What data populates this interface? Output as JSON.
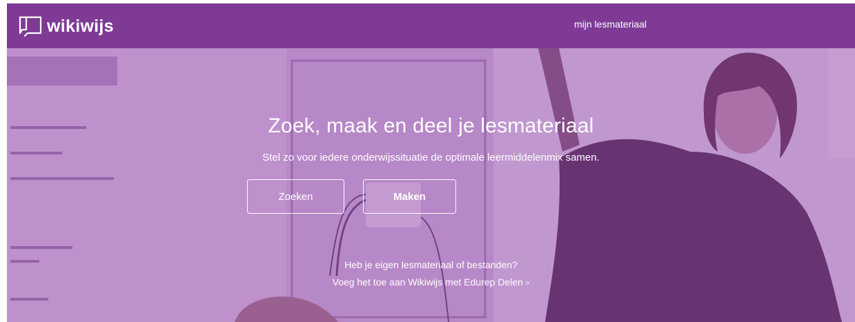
{
  "header": {
    "logo_text": "wikiwijs",
    "logo_icon": "speech-book-icon",
    "nav_link": "mijn lesmateriaal",
    "background_color": "#7f3a96"
  },
  "hero": {
    "title": "Zoek, maak en deel je lesmateriaal",
    "subtitle": "Stel zo voor iedere onderwijssituatie de optimale leermiddelenmix samen.",
    "buttons": {
      "search_label": "Zoeken",
      "make_label": "Maken"
    },
    "note": "Heb je eigen lesmateriaal of bestanden?",
    "link_text": "Voeg het toe aan Wikiwijs met Edurep Delen",
    "link_icon": "chevron-right-icon",
    "overlay_color": "#8e3ea8"
  }
}
